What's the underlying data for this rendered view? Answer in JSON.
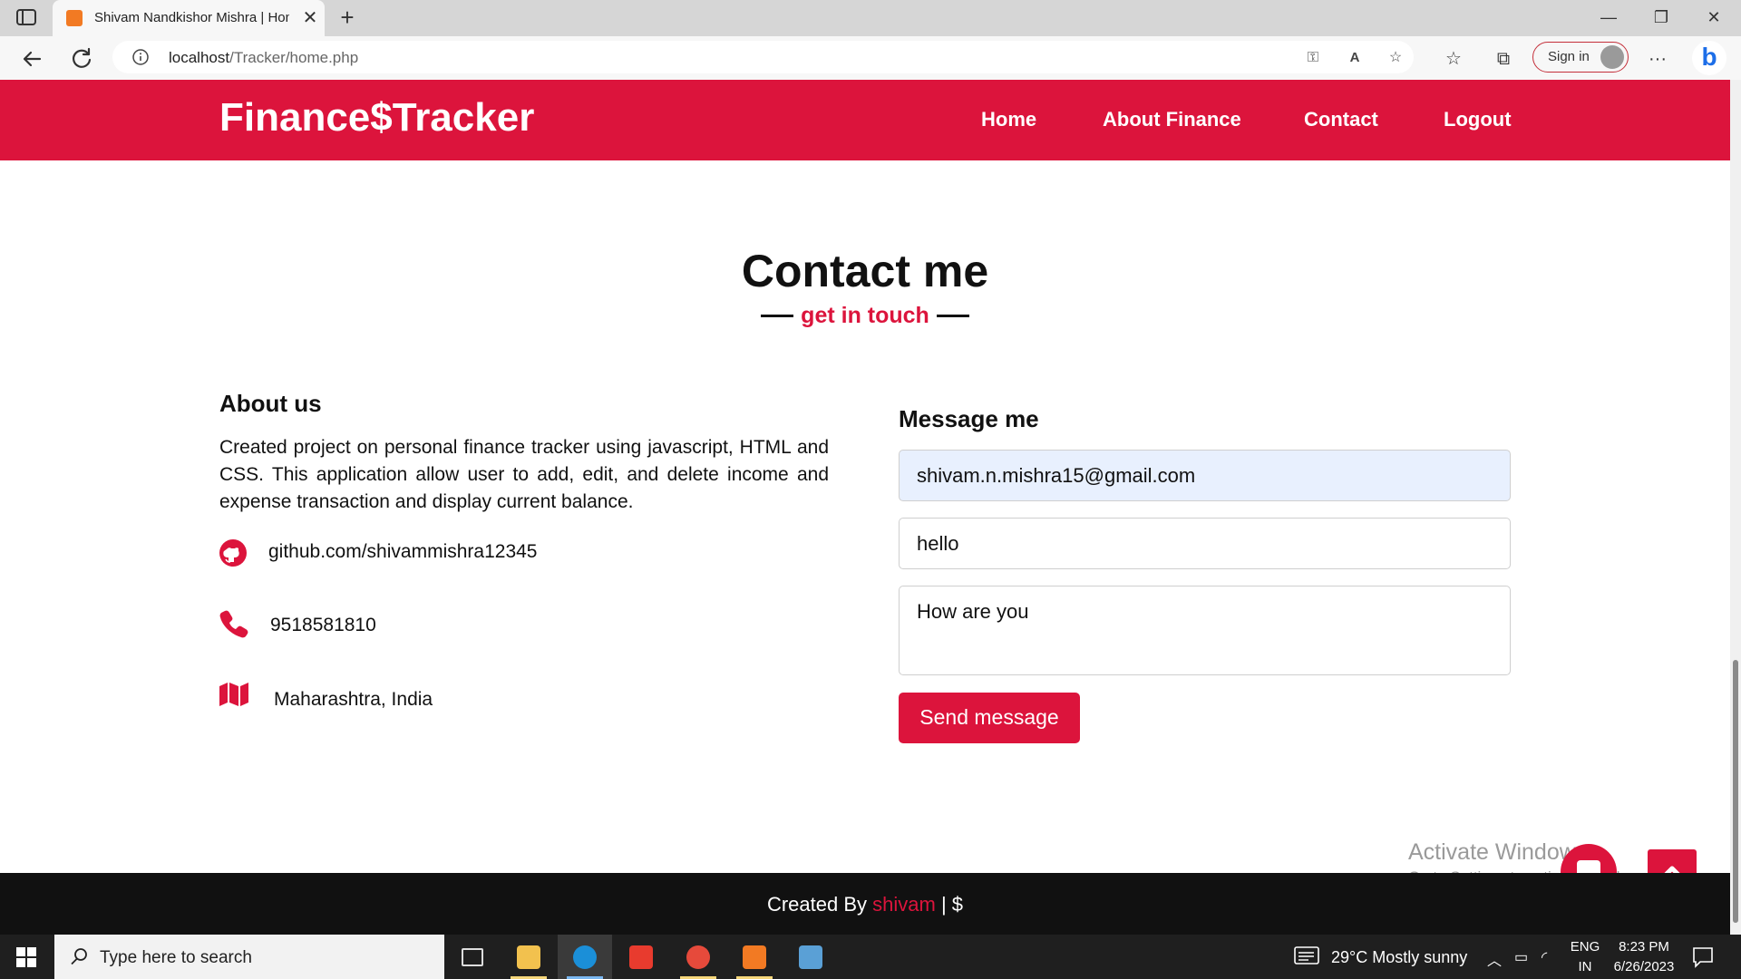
{
  "browser": {
    "tab_title": "Shivam Nandkishor Mishra | Hom",
    "tab_close": "✕",
    "new_tab": "+",
    "minimize": "—",
    "restore": "❐",
    "close": "✕",
    "url_host": "localhost",
    "url_path": "/Tracker/home.php",
    "sign_in": "Sign in",
    "more": "···",
    "bing_letter": "b"
  },
  "site": {
    "brand": "Finance$Tracker",
    "nav": [
      "Home",
      "About Finance",
      "Contact",
      "Logout"
    ]
  },
  "contact": {
    "title": "Contact me",
    "subtitle": "get in touch",
    "about_heading": "About us",
    "about_text": "Created project on personal finance tracker using javascript, HTML and CSS. This application allow user to add, edit, and delete income and expense transaction and display current balance.",
    "github": "github.com/shivammishra12345",
    "phone": "9518581810",
    "location": "Maharashtra, India",
    "message_heading": "Message me",
    "email_value": "shivam.n.mishra15@gmail.com",
    "subject_value": "hello",
    "message_value": "How are you",
    "send_label": "Send message"
  },
  "overlay": {
    "activate_title": "Activate Windows",
    "activate_sub": "Go to Settings to activate Windows."
  },
  "footer": {
    "prefix": "Created By ",
    "name": "shivam",
    "suffix": " | $"
  },
  "taskbar": {
    "search_placeholder": "Type here to search",
    "weather": "29°C  Mostly sunny",
    "lang_top": "ENG",
    "lang_bottom": "IN",
    "time": "8:23 PM",
    "date": "6/26/2023",
    "apps": [
      "task-view",
      "file-explorer",
      "edge",
      "wps-office",
      "chrome",
      "xampp",
      "virtualbox"
    ]
  },
  "colors": {
    "accent": "#dc143c",
    "footer_bg": "#111111",
    "email_fill": "#e8f0fe"
  }
}
